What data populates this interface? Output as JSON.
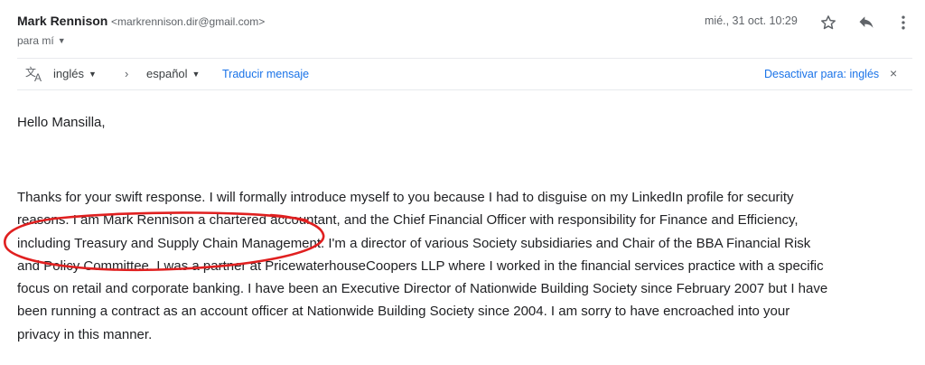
{
  "email": {
    "sender_name": "Mark Rennison",
    "sender_email": "<markrennison.dir@gmail.com>",
    "recipient": "para mí",
    "date": "mié., 31 oct. 10:29"
  },
  "icons": {
    "star": "star-icon",
    "reply": "reply-icon",
    "more": "more-vert-icon",
    "translate": "translate-icon"
  },
  "translate_bar": {
    "source_language": "inglés",
    "arrow": "›",
    "target_language": "español",
    "translate_link": "Traducir mensaje",
    "disable_link": "Desactivar para: inglés",
    "close": "×"
  },
  "body": {
    "greeting": "Hello Mansilla,",
    "lines": [
      "Thanks for your swift response. I will formally introduce myself to you because I had to disguise on my LinkedIn profile for security",
      "reasons. I am Mark Rennison a chartered accountant, and the Chief Financial Officer with responsibility for Finance and Efficiency,",
      "including Treasury and Supply Chain Management. I'm a director of various Society subsidiaries and Chair of the BBA Financial Risk",
      "and Policy Committee. I was a partner at PricewaterhouseCoopers LLP where I worked in the financial services practice with a specific",
      "focus on retail and corporate banking. I have been an Executive Director of Nationwide Building Society since February 2007 but I have",
      "been running a contract as an account officer at Nationwide Building Society since 2004. I am sorry to have encroached into your",
      "privacy in this manner."
    ]
  },
  "colors": {
    "link": "#1a73e8",
    "annotation": "#e02020",
    "text": "#202124",
    "muted": "#5f6368"
  }
}
